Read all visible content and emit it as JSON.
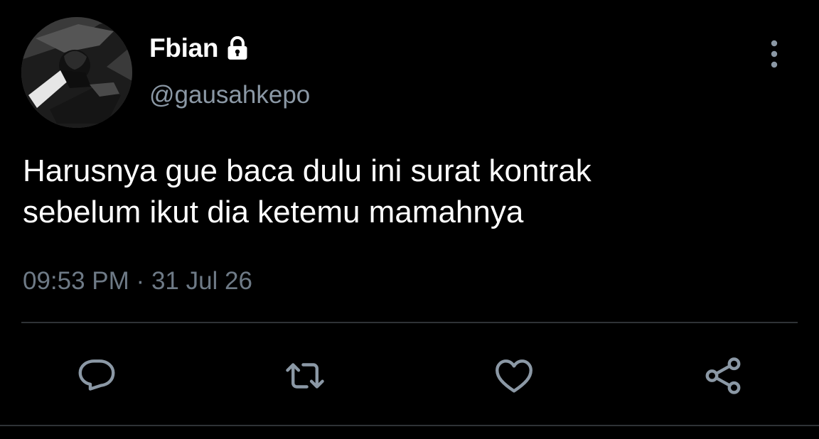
{
  "user": {
    "display_name": "Fbian",
    "handle": "@gausahkepo",
    "protected_icon": "lock-icon",
    "avatar": "profile-photo"
  },
  "tweet": {
    "lines": [
      "Harusnya gue baca dulu ini surat kontrak",
      "sebelum ikut dia ketemu mamahnya"
    ],
    "time": "09:53 PM",
    "separator": "·",
    "date": "31 Jul 26"
  },
  "actions": {
    "reply_icon": "reply-icon",
    "retweet_icon": "retweet-icon",
    "like_icon": "heart-icon",
    "share_icon": "share-icon",
    "more_icon": "more-vertical-icon"
  },
  "colors": {
    "background": "#000000",
    "primary_text": "#ffffff",
    "secondary_text": "#8b98a5",
    "icon": "#8b98a5",
    "divider": "#2f3336"
  }
}
